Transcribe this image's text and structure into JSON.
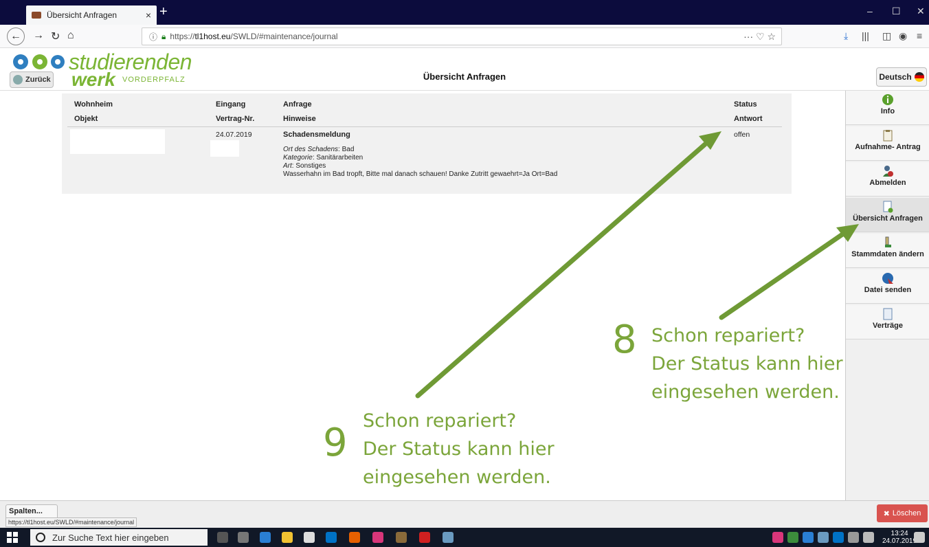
{
  "browser": {
    "tab_title": "Übersicht Anfragen",
    "tab_close": "×",
    "new_tab": "+",
    "url_prefix": "https://",
    "url_host": "tl1host.eu",
    "url_path": "/SWLD/#maintenance/journal",
    "page_actions": "··· ♡ ☆",
    "window_controls": [
      "–",
      "☐",
      "✕"
    ]
  },
  "header": {
    "logo_line1": "studierenden",
    "logo_line2": "werk",
    "logo_line3": "VORDERPFALZ",
    "back_label": "Zurück",
    "page_title": "Übersicht Anfragen",
    "language": "Deutsch"
  },
  "table": {
    "headers_row1": [
      "Wohnheim",
      "Eingang",
      "Anfrage",
      "Status"
    ],
    "headers_row2": [
      "Objekt",
      "Vertrag-Nr.",
      "Hinweise",
      "Antwort"
    ],
    "row": {
      "date": "24.07.2019",
      "title": "Schadensmeldung",
      "status": "offen",
      "ort_label": "Ort des Schadens",
      "ort_value": ": Bad",
      "kategorie_label": "Kategorie",
      "kategorie_value": ": Sanitärarbeiten",
      "art_label": "Art",
      "art_value": ": Sonstiges",
      "text": "Wasserhahn im Bad tropft, Bitte mal danach schauen! Danke Zutritt gewaehrt=Ja Ort=Bad"
    }
  },
  "sidebar": {
    "items": [
      {
        "label": "Info",
        "icon": "info-icon",
        "color": "#5aa02c"
      },
      {
        "label": "Aufnahme- Antrag",
        "icon": "clipboard-icon",
        "color": "#8c7b4a"
      },
      {
        "label": "Abmelden",
        "icon": "user-logout-icon",
        "color": "#c03030"
      },
      {
        "label": "Übersicht Anfragen",
        "icon": "document-check-icon",
        "color": "#5aa02c"
      },
      {
        "label": "Stammdaten ändern",
        "icon": "pen-icon",
        "color": "#3c8c3c"
      },
      {
        "label": "Datei senden",
        "icon": "globe-send-icon",
        "color": "#2a6ab0"
      },
      {
        "label": "Verträge",
        "icon": "contract-icon",
        "color": "#6a8ab0"
      }
    ]
  },
  "footer": {
    "spalten": "Spalten...",
    "status_url": "https://tl1host.eu/SWLD/#maintenance/journal",
    "delete_label": "Löschen"
  },
  "taskbar": {
    "search_placeholder": "Zur Suche Text hier eingeben",
    "time": "13:24",
    "date": "24.07.2019"
  },
  "annotations": {
    "a8_num": "8",
    "a8_lines": [
      "Schon repariert?",
      "Der Status kann hier",
      "eingesehen werden."
    ],
    "a9_num": "9",
    "a9_lines": [
      "Schon repariert?",
      "Der Status kann hier",
      "eingesehen werden."
    ],
    "arrow_color": "#6f9a35"
  }
}
